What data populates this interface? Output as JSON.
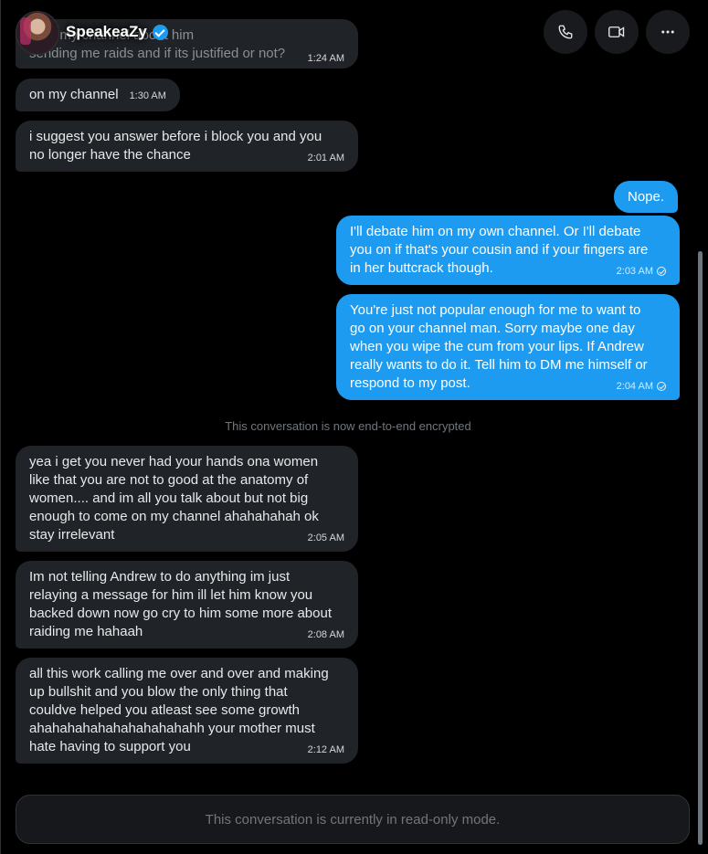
{
  "header": {
    "name": "SpeakeaZy",
    "verified_icon": "verified-badge-icon",
    "buttons": [
      {
        "icon": "phone-icon"
      },
      {
        "icon": "video-icon"
      },
      {
        "icon": "more-icon"
      }
    ]
  },
  "messages": [
    {
      "dir": "in",
      "text": "...on my channel about him\nsending me raids and if its justified or not?",
      "time": "1:24 AM"
    },
    {
      "dir": "in",
      "text": "on my channel",
      "time": "1:30 AM"
    },
    {
      "dir": "in",
      "text": "i suggest you answer before i block you and you\nno longer have the chance",
      "time": "2:01 AM"
    },
    {
      "dir": "out",
      "text": "Nope.",
      "time": ""
    },
    {
      "dir": "out",
      "text": "I'll debate him on my own channel. Or I'll debate\nyou on if that's your cousin and if your fingers are\nin her buttcrack though.",
      "time": "2:03 AM"
    },
    {
      "dir": "out",
      "text": "You're just not popular enough for me to want to\ngo on your channel man. Sorry maybe one day\nwhen you wipe the cum from your lips. If Andrew\nreally wants to do it. Tell him to DM me himself or\nrespond to my post.",
      "time": "2:04 AM"
    },
    {
      "dir": "in",
      "text": "yea i get you never had your hands ona  women\nlike that you are not to good at the anatomy of\nwomen.... and im all you talk about but not big\nenough to come on my channel ahahahahah ok\nstay irrelevant",
      "time": "2:05 AM"
    },
    {
      "dir": "in",
      "text": "Im not telling Andrew to do anything im just\nrelaying a message for him ill let him know you\nbacked down now go cry to him some more about\nraiding me hahaah",
      "time": "2:08 AM"
    },
    {
      "dir": "in",
      "text": "all this work calling me over and over and making\nup bullshit and you blow the only thing that\ncouldve helped you atleast see some growth\nahahahahahahahahahahahh your mother must\nhate having to support you",
      "time": "2:12 AM"
    }
  ],
  "system_notice": "This conversation is now end-to-end encrypted",
  "footer": {
    "readonly_text": "This conversation is currently in read-only mode."
  },
  "colors": {
    "outgoing": "#1d9bf0",
    "incoming": "#202327",
    "background": "#000000"
  }
}
